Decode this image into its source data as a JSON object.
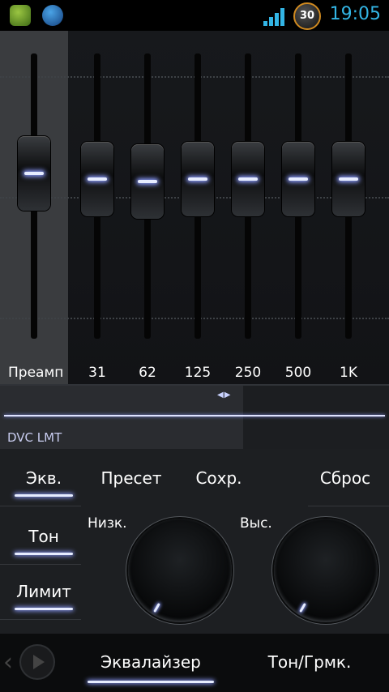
{
  "status_bar": {
    "time": "19:05",
    "badge": "30",
    "icons": [
      "app-shield-icon",
      "app-globe-icon",
      "signal-icon",
      "battery-badge-icon"
    ],
    "accent_color": "#33b5e5"
  },
  "equalizer": {
    "bands": [
      {
        "label": "Преамп",
        "level": 0.42
      },
      {
        "label": "31",
        "level": 0.44
      },
      {
        "label": "62",
        "level": 0.45
      },
      {
        "label": "125",
        "level": 0.44
      },
      {
        "label": "250",
        "level": 0.44
      },
      {
        "label": "500",
        "level": 0.44
      },
      {
        "label": "1K",
        "level": 0.44
      }
    ],
    "glow_color": "#8d9dff"
  },
  "dvc": {
    "label": "DVC LMT",
    "arrows": "◀▶"
  },
  "side_tabs": {
    "eq": "Экв.",
    "tone": "Тон",
    "limit": "Лимит"
  },
  "toolbar": {
    "preset": "Пресет",
    "save": "Сохр.",
    "reset": "Сброс"
  },
  "dials": {
    "low_label": "Низк.",
    "high_label": "Выс."
  },
  "bottom_tabs": {
    "equalizer": "Эквалайзер",
    "tone_volume": "Тон/Грмк."
  }
}
